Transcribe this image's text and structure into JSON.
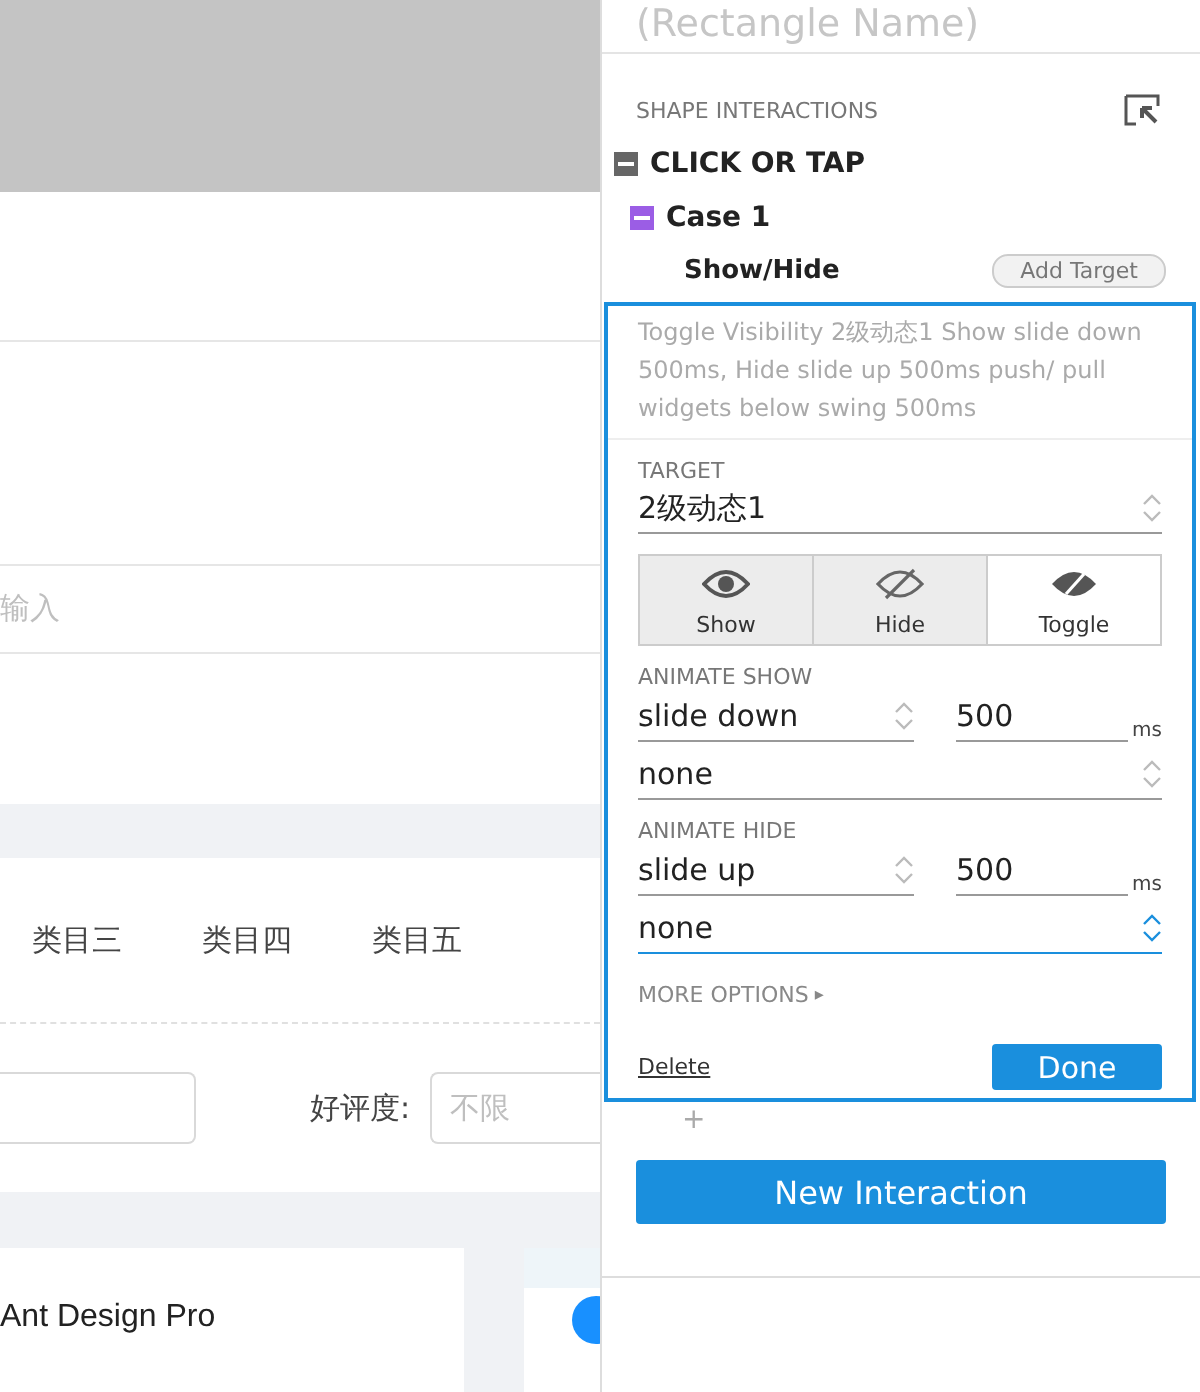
{
  "canvas": {
    "search_placeholder": "输入",
    "tabs": [
      {
        "label": "类目三"
      },
      {
        "label": "类目四"
      },
      {
        "label": "类目五"
      }
    ],
    "rating_label": "好评度:",
    "rating_placeholder": "不限",
    "card_title": "Ant Design Pro"
  },
  "panel": {
    "title": "(Rectangle Name)",
    "section": "SHAPE INTERACTIONS",
    "event": {
      "label": "CLICK OR TAP",
      "expanded": true
    },
    "case": {
      "label": "Case 1",
      "expanded": true
    },
    "action": {
      "label": "Show/Hide",
      "add_target": "Add Target"
    },
    "summary": "Toggle Visibility 2级动态1 Show slide down 500ms, Hide slide up 500ms push/ pull widgets below swing 500ms",
    "target_label": "TARGET",
    "target_value": "2级动态1",
    "modes": [
      {
        "label": "Show",
        "kind": "show",
        "selected": false
      },
      {
        "label": "Hide",
        "kind": "hide",
        "selected": false
      },
      {
        "label": "Toggle",
        "kind": "toggle",
        "selected": true
      }
    ],
    "animations": [
      {
        "label": "ANIMATE SHOW",
        "effect": "slide down",
        "duration": "500",
        "unit": "ms",
        "easing": "none",
        "focused": false
      },
      {
        "label": "ANIMATE HIDE",
        "effect": "slide up",
        "duration": "500",
        "unit": "ms",
        "easing": "none",
        "focused": true
      }
    ],
    "more_options": "MORE OPTIONS",
    "more_arrow": "▸",
    "delete": "Delete",
    "done": "Done",
    "add": "+",
    "new_interaction": "New Interaction"
  }
}
